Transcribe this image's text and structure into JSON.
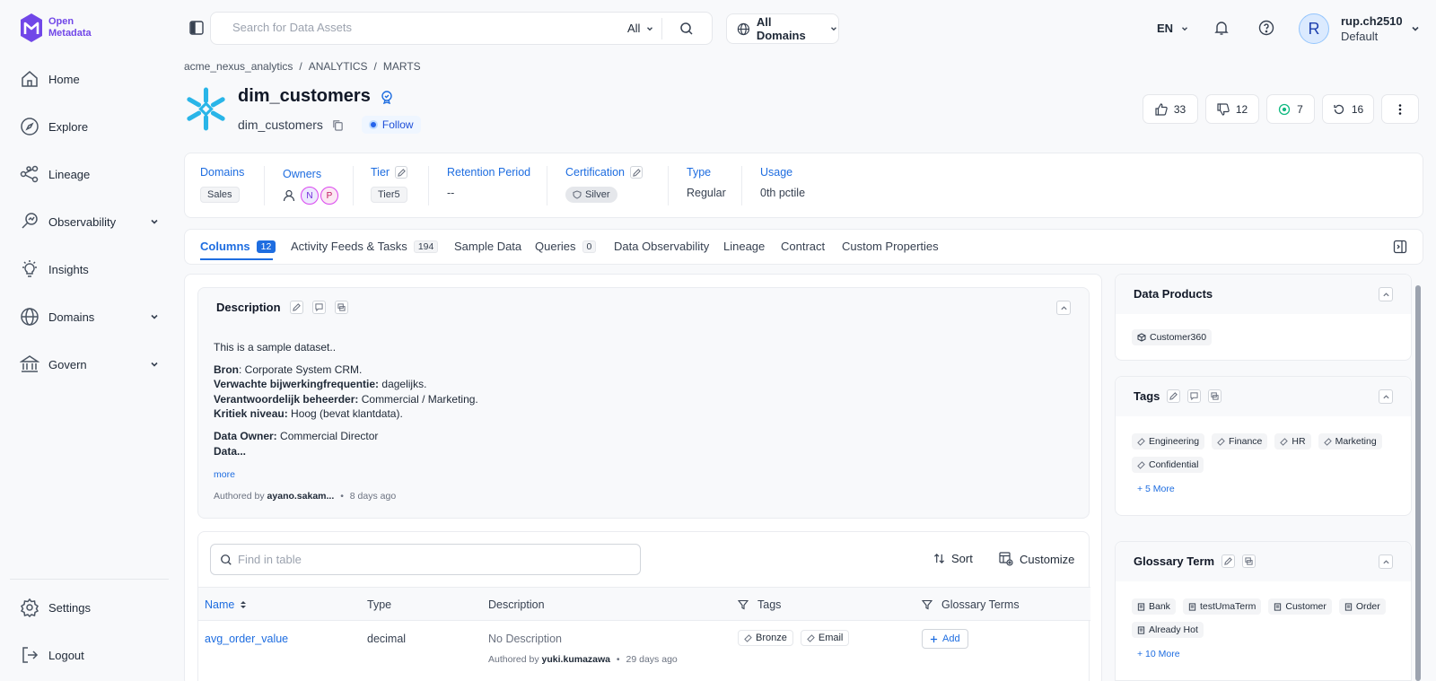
{
  "app": {
    "logo_text_1": "Open",
    "logo_text_2": "Metadata"
  },
  "sidebar": {
    "items": [
      {
        "label": "Home",
        "icon": "home-icon"
      },
      {
        "label": "Explore",
        "icon": "explore-icon"
      },
      {
        "label": "Lineage",
        "icon": "lineage-icon"
      },
      {
        "label": "Observability",
        "icon": "observability-icon"
      },
      {
        "label": "Insights",
        "icon": "insights-icon"
      },
      {
        "label": "Domains",
        "icon": "domains-icon"
      },
      {
        "label": "Govern",
        "icon": "govern-icon"
      }
    ],
    "settings": "Settings",
    "logout": "Logout"
  },
  "topbar": {
    "search_placeholder": "Search for Data Assets",
    "search_scope": "All",
    "domain": "All Domains",
    "language": "EN",
    "avatar_letter": "R",
    "user_name": "rup.ch2510",
    "user_role": "Default"
  },
  "breadcrumb": [
    "acme_nexus_analytics",
    "ANALYTICS",
    "MARTS"
  ],
  "entity": {
    "title": "dim_customers",
    "subtitle": "dim_customers",
    "follow": "Follow",
    "votes": {
      "up": "33",
      "down": "12",
      "tasks": "7",
      "versions": "16"
    }
  },
  "meta": {
    "domains_label": "Domains",
    "domains_value": "Sales",
    "owners_label": "Owners",
    "owner_1": "N",
    "owner_2": "P",
    "tier_label": "Tier",
    "tier_value": "Tier5",
    "retention_label": "Retention Period",
    "retention_value": "--",
    "certification_label": "Certification",
    "certification_value": "Silver",
    "type_label": "Type",
    "type_value": "Regular",
    "usage_label": "Usage",
    "usage_value": "0th pctile"
  },
  "tabs": [
    {
      "label": "Columns",
      "count": "12"
    },
    {
      "label": "Activity Feeds & Tasks",
      "count": "194"
    },
    {
      "label": "Sample Data"
    },
    {
      "label": "Queries",
      "count": "0"
    },
    {
      "label": "Data Observability"
    },
    {
      "label": "Lineage"
    },
    {
      "label": "Contract"
    },
    {
      "label": "Custom Properties"
    }
  ],
  "description": {
    "title": "Description",
    "intro": "This is a sample dataset..",
    "lines": [
      {
        "k": "Bron",
        "v": ": Corporate System CRM."
      },
      {
        "k": "Verwachte bijwerkingfrequentie:",
        "v": " dagelijks."
      },
      {
        "k": "Verantwoordelijk beheerder:",
        "v": " Commercial / Marketing."
      },
      {
        "k": "Kritiek niveau:",
        "v": " Hoog (bevat klantdata)."
      }
    ],
    "owner_k": "Data Owner:",
    "owner_v": " Commercial Director",
    "trunc": "Data...",
    "more": "more",
    "authored_prefix": "Authored by",
    "authored_by": "ayano.sakam...",
    "authored_when": "8 days ago"
  },
  "table": {
    "find_placeholder": "Find in table",
    "sort": "Sort",
    "customize": "Customize",
    "headers": [
      "Name",
      "Type",
      "Description",
      "Tags",
      "Glossary Terms"
    ],
    "row": {
      "name": "avg_order_value",
      "type": "decimal",
      "desc": "No Description",
      "authored_prefix": "Authored by",
      "authored_by": "yuki.kumazawa",
      "authored_when": "29 days ago",
      "tags": [
        "Bronze",
        "Email"
      ],
      "add": "Add"
    }
  },
  "right": {
    "data_products_title": "Data Products",
    "data_products": [
      "Customer360"
    ],
    "tags_title": "Tags",
    "tags": [
      "Engineering",
      "Finance",
      "HR",
      "Marketing",
      "Confidential"
    ],
    "tags_more": "+ 5 More",
    "glossary_title": "Glossary Term",
    "glossary": [
      "Bank",
      "testUmaTerm",
      "Customer",
      "Order",
      "Already Hot"
    ],
    "glossary_more": "+ 10 More"
  },
  "colors": {
    "accent": "#1e6de0",
    "brand": "#7147e8",
    "snowflake": "#29b5e8"
  }
}
